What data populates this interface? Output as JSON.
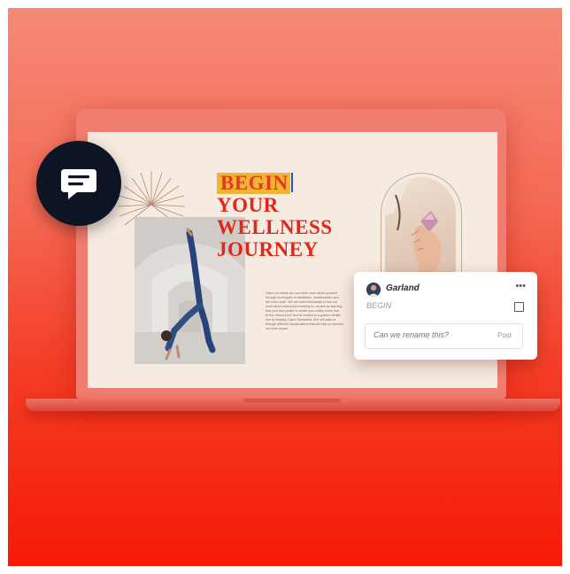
{
  "document": {
    "headline_word1": "BEGIN",
    "headline_line2": "YOUR",
    "headline_line3": "WELLNESS",
    "headline_line4": "JOURNEY",
    "body_text": "Claire uzi others are you learn more about yourself through techniques of meditation, manifestation and the lunar cycle. We will meet individually to find out more about what you're looking for, as well as learning that your own power to create your reality come true. At the retreat you'll find be treated to a guided medita- tion by leading Coach Samantha. She will walk us through different visualizations that will help us harness our inner power."
  },
  "comment": {
    "user_name": "Garland",
    "more_label": "•••",
    "reference": "BEGIN",
    "reply_placeholder": "Can we rename this?",
    "post_label": "Post"
  },
  "icons": {
    "chat": "chat-bubble-icon",
    "more": "more-options-icon",
    "resolve": "checkbox-icon",
    "avatar": "user-avatar"
  },
  "colors": {
    "background_top": "#f58a76",
    "background_bottom": "#f61a06",
    "laptop": "#f07d70",
    "screen": "#f6ebe0",
    "headline_red": "#e2261a",
    "highlight_yellow": "#f2b432",
    "chat_circle": "#0d1424"
  }
}
